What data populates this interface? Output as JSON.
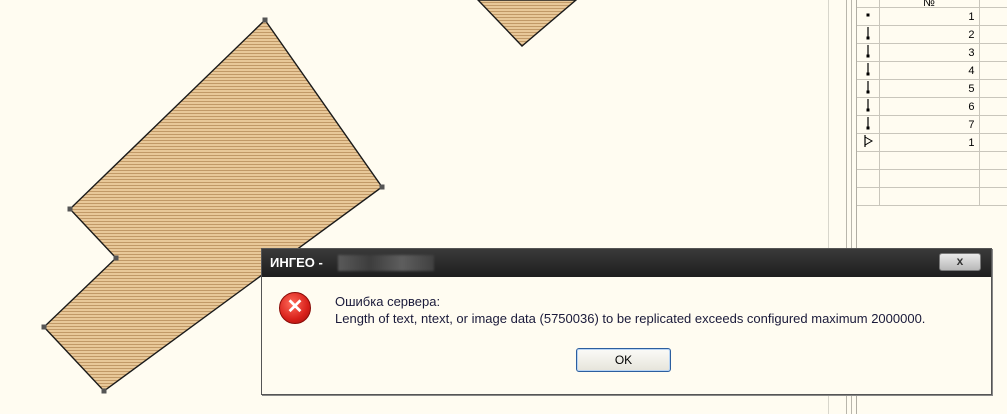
{
  "map": {
    "colors": {
      "fill": "#e6c493",
      "stroke": "#1a1a1a",
      "vertex": "#555555"
    }
  },
  "table": {
    "header": "№",
    "rows": [
      {
        "icon": "point-icon",
        "value": "1"
      },
      {
        "icon": "line-vertical-icon",
        "value": "2"
      },
      {
        "icon": "line-vertical-icon",
        "value": "3"
      },
      {
        "icon": "line-vertical-icon",
        "value": "4"
      },
      {
        "icon": "line-vertical-icon",
        "value": "5"
      },
      {
        "icon": "line-vertical-icon",
        "value": "6"
      },
      {
        "icon": "line-vertical-icon",
        "value": "7"
      },
      {
        "icon": "triangle-right-icon",
        "value": "1"
      }
    ]
  },
  "dialog": {
    "title": "ИНГЕО -",
    "close_label": "x",
    "icon": "error-icon",
    "message_line1": "Ошибка сервера:",
    "message_line2": "Length of text, ntext, or image data (5750036) to be replicated exceeds configured maximum 2000000.",
    "ok_label": "OK"
  }
}
